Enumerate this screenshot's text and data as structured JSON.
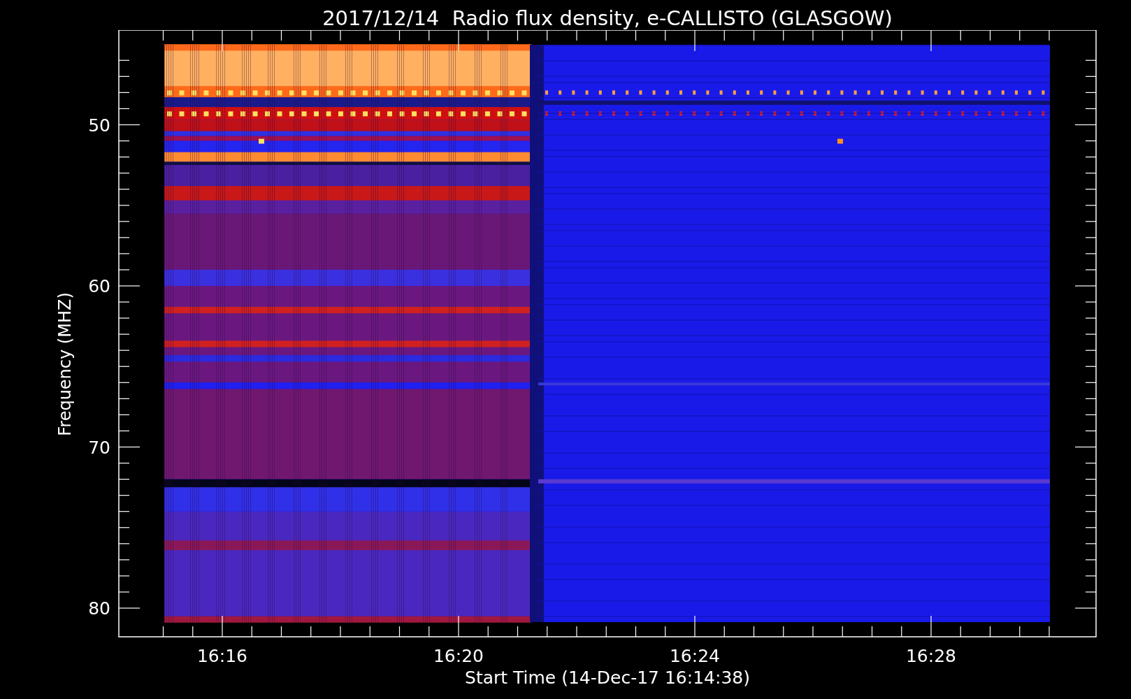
{
  "title": "2017/12/14  Radio flux density, e-CALLISTO (GLASGOW)",
  "y_axis": {
    "label": "Frequency (MHZ)",
    "ticks": [
      "50",
      "60",
      "70",
      "80"
    ]
  },
  "x_axis": {
    "label": "Start Time (14-Dec-17 16:14:38)",
    "ticks": [
      "16:16",
      "16:20",
      "16:24",
      "16:28"
    ]
  }
}
